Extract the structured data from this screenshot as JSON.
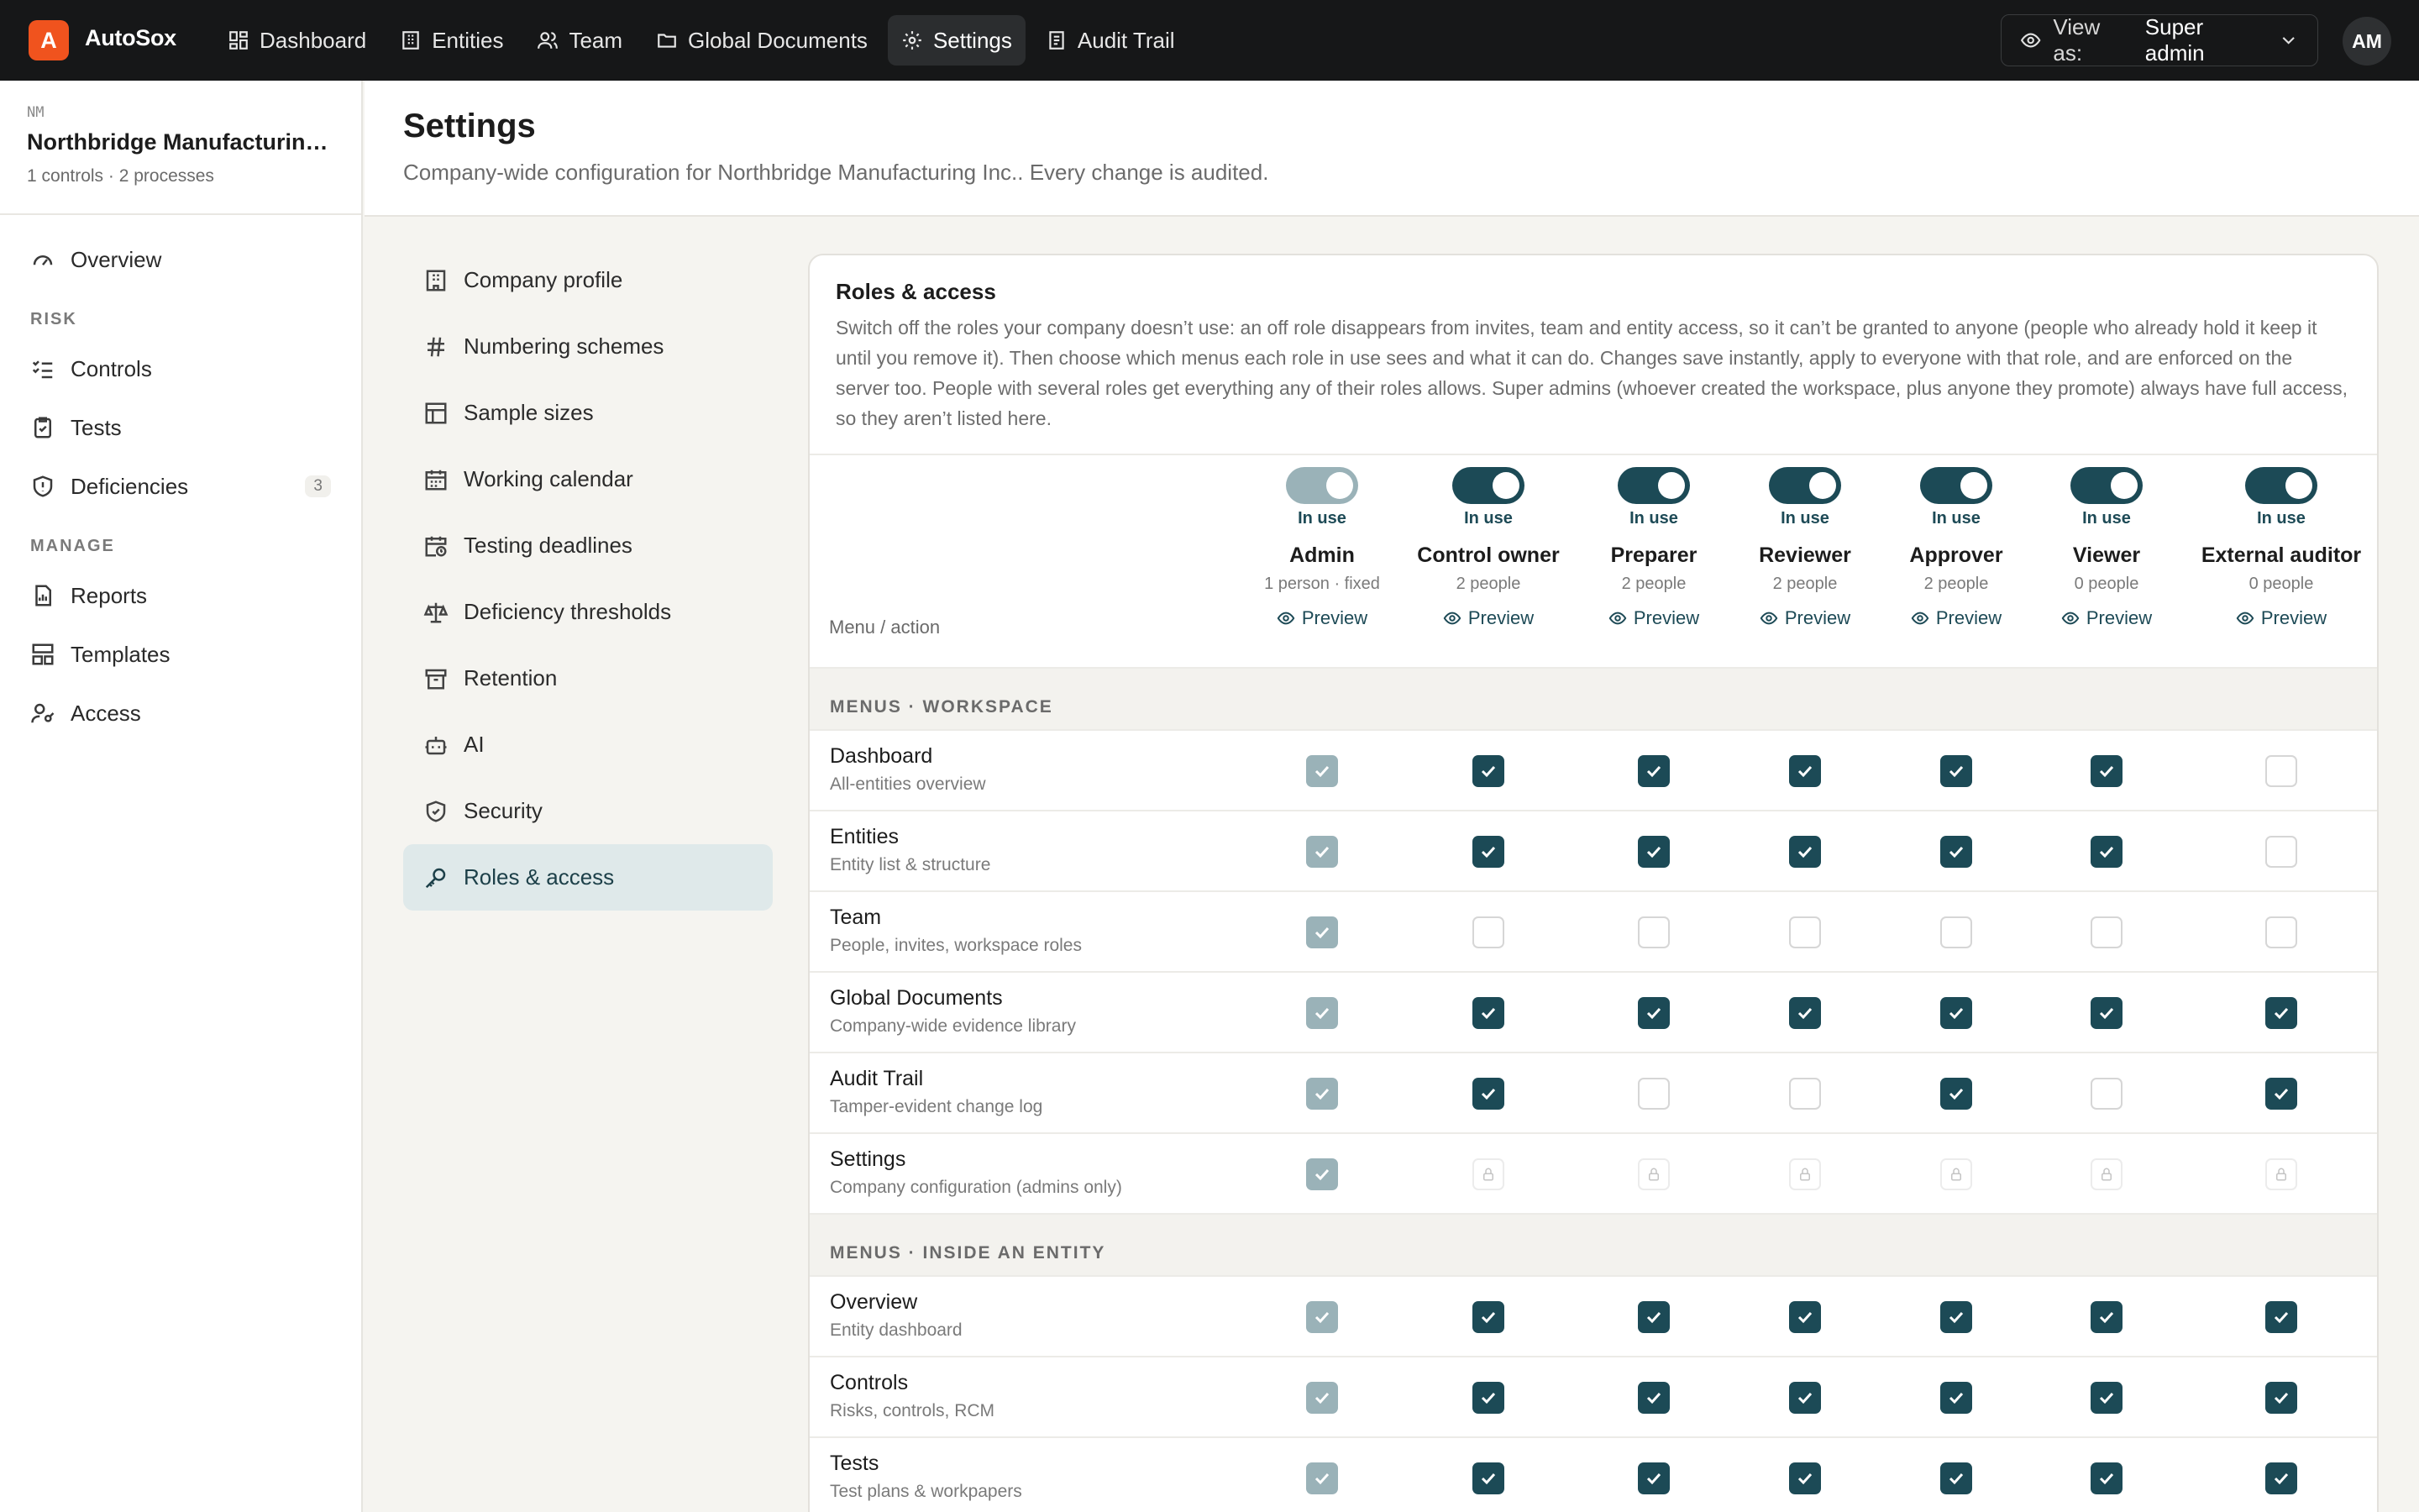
{
  "app": {
    "logo_letter": "A",
    "name": "AutoSox"
  },
  "nav": [
    {
      "label": "Dashboard",
      "icon": "dashboard-icon"
    },
    {
      "label": "Entities",
      "icon": "building-icon"
    },
    {
      "label": "Team",
      "icon": "users-icon"
    },
    {
      "label": "Global Documents",
      "icon": "folder-icon"
    },
    {
      "label": "Settings",
      "icon": "gear-icon",
      "active": true
    },
    {
      "label": "Audit Trail",
      "icon": "audit-log-icon"
    }
  ],
  "view_as": {
    "label": "View as:",
    "value": "Super admin"
  },
  "user": {
    "initials": "AM"
  },
  "entity": {
    "abbr": "NM",
    "name": "Northbridge Manufacturing Inc.",
    "meta": "1 controls · 2 processes"
  },
  "sidebar": {
    "overview": "Overview",
    "risk_label": "RISK",
    "controls": "Controls",
    "tests": "Tests",
    "deficiencies": "Deficiencies",
    "deficiencies_count": "3",
    "manage_label": "MANAGE",
    "reports": "Reports",
    "templates": "Templates",
    "access": "Access"
  },
  "page": {
    "title": "Settings",
    "subtitle": "Company-wide configuration for Northbridge Manufacturing Inc.. Every change is audited."
  },
  "settings_nav": [
    {
      "label": "Company profile",
      "icon": "building-icon"
    },
    {
      "label": "Numbering schemes",
      "icon": "hash-icon"
    },
    {
      "label": "Sample sizes",
      "icon": "table-icon"
    },
    {
      "label": "Working calendar",
      "icon": "calendar-icon"
    },
    {
      "label": "Testing deadlines",
      "icon": "calendar-clock-icon"
    },
    {
      "label": "Deficiency thresholds",
      "icon": "scale-icon"
    },
    {
      "label": "Retention",
      "icon": "archive-icon"
    },
    {
      "label": "AI",
      "icon": "bot-icon"
    },
    {
      "label": "Security",
      "icon": "shield-icon"
    },
    {
      "label": "Roles & access",
      "icon": "key-icon",
      "active": true
    }
  ],
  "roles_card": {
    "title": "Roles & access",
    "description": "Switch off the roles your company doesn’t use: an off role disappears from invites, team and entity access, so it can’t be granted to anyone (people who already hold it keep it until you remove it). Then choose which menus each role in use sees and what it can do. Changes save instantly, apply to everyone with that role, and are enforced on the server too. People with several roles get everything any of their roles allows. Super admins (whoever created the workspace, plus anyone they promote) always have full access, so they aren’t listed here.",
    "column_label": "Menu / action",
    "in_use_label": "In use",
    "preview_label": "Preview"
  },
  "roles": [
    {
      "name": "Admin",
      "count": "1 person · fixed",
      "in_use": true,
      "fixed": true
    },
    {
      "name": "Control owner",
      "count": "2 people",
      "in_use": true
    },
    {
      "name": "Preparer",
      "count": "2 people",
      "in_use": true
    },
    {
      "name": "Reviewer",
      "count": "2 people",
      "in_use": true
    },
    {
      "name": "Approver",
      "count": "2 people",
      "in_use": true
    },
    {
      "name": "Viewer",
      "count": "0 people",
      "in_use": true
    },
    {
      "name": "External auditor",
      "count": "0 people",
      "in_use": true
    }
  ],
  "sections": [
    {
      "title": "MENUS · WORKSPACE",
      "rows": [
        {
          "name": "Dashboard",
          "desc": "All-entities overview",
          "perms": [
            "fixed",
            "on",
            "on",
            "on",
            "on",
            "on",
            "off"
          ]
        },
        {
          "name": "Entities",
          "desc": "Entity list & structure",
          "perms": [
            "fixed",
            "on",
            "on",
            "on",
            "on",
            "on",
            "off"
          ]
        },
        {
          "name": "Team",
          "desc": "People, invites, workspace roles",
          "perms": [
            "fixed",
            "off",
            "off",
            "off",
            "off",
            "off",
            "off"
          ]
        },
        {
          "name": "Global Documents",
          "desc": "Company-wide evidence library",
          "perms": [
            "fixed",
            "on",
            "on",
            "on",
            "on",
            "on",
            "on"
          ]
        },
        {
          "name": "Audit Trail",
          "desc": "Tamper-evident change log",
          "perms": [
            "fixed",
            "on",
            "off",
            "off",
            "on",
            "off",
            "on"
          ]
        },
        {
          "name": "Settings",
          "desc": "Company configuration (admins only)",
          "perms": [
            "fixed",
            "locked",
            "locked",
            "locked",
            "locked",
            "locked",
            "locked"
          ]
        }
      ]
    },
    {
      "title": "MENUS · INSIDE AN ENTITY",
      "rows": [
        {
          "name": "Overview",
          "desc": "Entity dashboard",
          "perms": [
            "fixed",
            "on",
            "on",
            "on",
            "on",
            "on",
            "on"
          ]
        },
        {
          "name": "Controls",
          "desc": "Risks, controls, RCM",
          "perms": [
            "fixed",
            "on",
            "on",
            "on",
            "on",
            "on",
            "on"
          ]
        },
        {
          "name": "Tests",
          "desc": "Test plans & workpapers",
          "perms": [
            "fixed",
            "on",
            "on",
            "on",
            "on",
            "on",
            "on"
          ]
        }
      ]
    }
  ],
  "colors": {
    "accent": "#1c4a56",
    "accent_fixed": "#9ab2b8",
    "brand": "#f0531e",
    "topbar": "#161718"
  }
}
